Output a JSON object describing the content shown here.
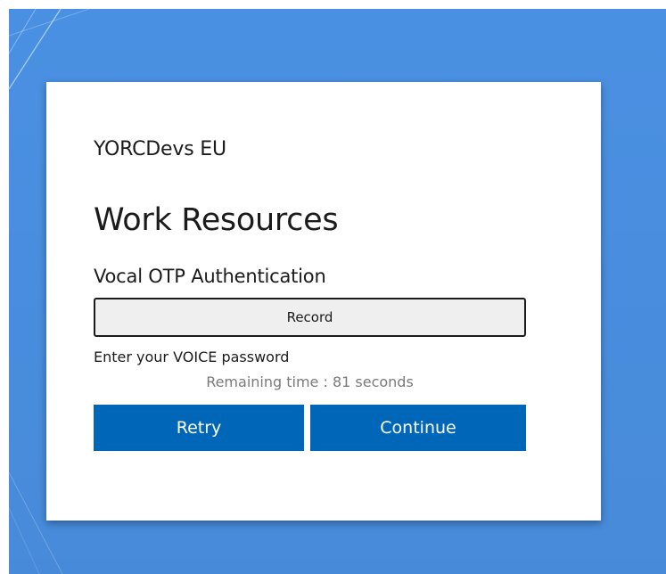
{
  "card": {
    "brand": "YORCDevs EU",
    "title": "Work Resources",
    "subtitle": "Vocal OTP Authentication",
    "record_label": "Record",
    "instruction": "Enter your VOICE password",
    "remaining_time": "Remaining time : 81 seconds",
    "retry_label": "Retry",
    "continue_label": "Continue"
  },
  "colors": {
    "desktop_background": "#4a90e2",
    "card_background": "#ffffff",
    "primary_button": "#0067b8",
    "record_button": "#efefef",
    "muted_text": "#7a7a7a"
  }
}
